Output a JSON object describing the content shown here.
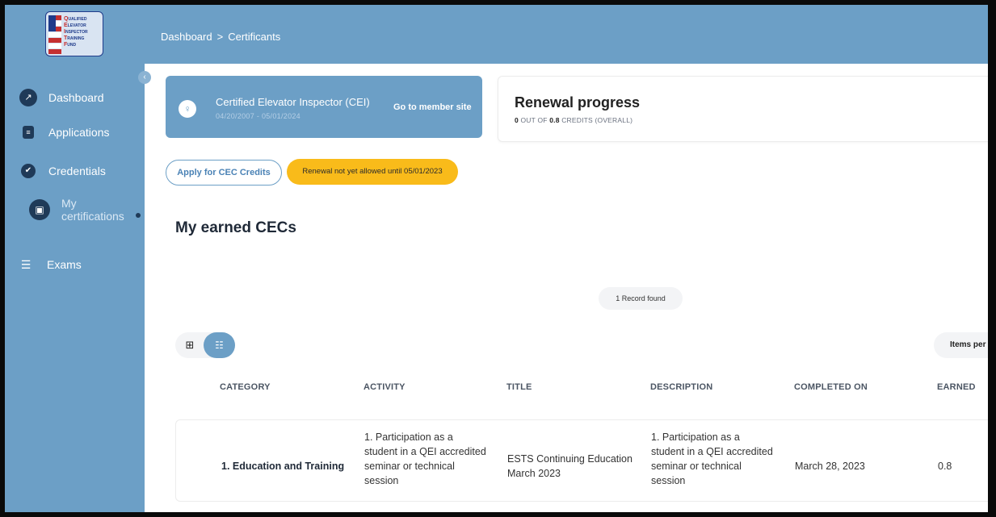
{
  "sidebar": {
    "logo_text": [
      "QUALIFIED",
      "ELEVATOR",
      "INSPECTOR",
      "TRAINING",
      "FUND"
    ],
    "collapse_icon": "chevron-left-icon",
    "items": [
      {
        "label": "Dashboard",
        "icon": "trend-up-icon"
      },
      {
        "label": "Applications",
        "icon": "document-icon"
      },
      {
        "label": "Credentials",
        "icon": "verified-badge-icon"
      },
      {
        "label_line1": "My",
        "label_line2": "certifications",
        "icon": "id-card-icon",
        "active": true
      },
      {
        "label": "Exams",
        "icon": "list-edit-icon"
      }
    ]
  },
  "header": {
    "breadcrumb": [
      "Dashboard",
      "Certificants"
    ],
    "separator": ">"
  },
  "cert_card": {
    "title": "Certified Elevator Inspector (CEI)",
    "dates": "04/20/2007  -  05/01/2024",
    "member_link": "Go to member site"
  },
  "renewal": {
    "title": "Renewal progress",
    "progress_count": "0",
    "progress_mid": " OUT OF ",
    "progress_total": "0.8",
    "progress_suffix": " CREDITS (OVERALL)"
  },
  "actions": {
    "apply_label": "Apply for CEC Credits",
    "renewal_badge": "Renewal not yet allowed until 05/01/2023"
  },
  "section_title": "My earned CECs",
  "records_found": "1 Record found",
  "items_per_page_label": "Items per",
  "table": {
    "headers": [
      "CATEGORY",
      "ACTIVITY",
      "TITLE",
      "DESCRIPTION",
      "COMPLETED ON",
      "EARNED"
    ],
    "rows": [
      {
        "category": "1. Education and Training",
        "activity": [
          "1. Participation as a",
          "student in a QEI accredited",
          "seminar or technical",
          "session"
        ],
        "title": [
          "ESTS Continuing Education",
          "March 2023"
        ],
        "description": [
          "1. Participation as a",
          "student in a QEI accredited",
          "seminar or technical",
          "session"
        ],
        "completed_on": "March 28, 2023",
        "earned": "0.8"
      }
    ]
  },
  "colors": {
    "primary": "#6c9fc6",
    "dark_navy": "#1f3a58",
    "warning": "#f9bb1a"
  }
}
